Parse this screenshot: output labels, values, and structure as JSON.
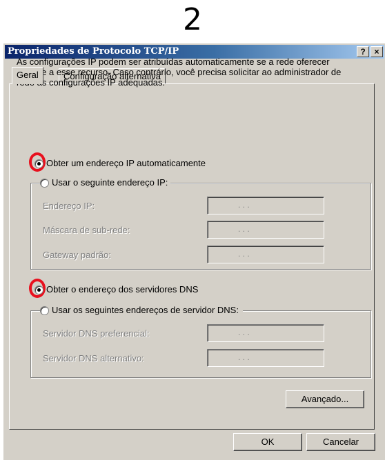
{
  "step_number": "2",
  "window": {
    "title": "Propriedades de Protocolo TCP/IP",
    "help_button": "?",
    "close_button": "×"
  },
  "tabs": [
    {
      "label": "Geral",
      "active": true
    },
    {
      "label": "Configuração alternativa",
      "active": false
    }
  ],
  "description": "As configurações IP podem ser atribuídas automaticamente se a rede oferecer suporte a esse recurso. Caso contrário, você precisa solicitar ao administrador de rede as configurações IP adequadas.",
  "ip_section": {
    "auto_option": "Obter um endereço IP automaticamente",
    "auto_selected": true,
    "manual_option": "Usar o seguinte endereço IP:",
    "fields": [
      {
        "label": "Endereço IP:",
        "dots": ". . ."
      },
      {
        "label": "Máscara de sub-rede:",
        "dots": ". . ."
      },
      {
        "label": "Gateway padrão:",
        "dots": ". . ."
      }
    ]
  },
  "dns_section": {
    "auto_option": "Obter o endereço dos servidores DNS",
    "auto_selected": true,
    "manual_option": "Usar os seguintes endereços de servidor DNS:",
    "fields": [
      {
        "label": "Servidor DNS preferencial:",
        "dots": ". . ."
      },
      {
        "label": "Servidor DNS alternativo:",
        "dots": ". . ."
      }
    ]
  },
  "buttons": {
    "advanced": "Avançado...",
    "ok": "OK",
    "cancel": "Cancelar"
  },
  "colors": {
    "highlight_ring": "#e8101e",
    "titlebar_start": "#0a246a",
    "dialog_bg": "#d4d0c8"
  }
}
